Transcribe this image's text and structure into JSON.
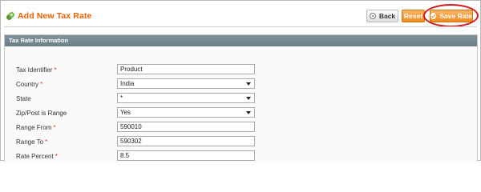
{
  "header": {
    "title": "Add New Tax Rate",
    "title_icon": "tax-rate-icon",
    "back_label": "Back",
    "reset_label": "Reset",
    "save_label": "Save Rate"
  },
  "section": {
    "title": "Tax Rate Information"
  },
  "form": {
    "tax_identifier": {
      "label": "Tax Identifier",
      "required": "*",
      "value": "Product"
    },
    "country": {
      "label": "Country",
      "required": "*",
      "value": "India"
    },
    "state": {
      "label": "State",
      "value": "*"
    },
    "zip_post_range": {
      "label": "Zip/Post is Range",
      "value": "Yes"
    },
    "range_from": {
      "label": "Range From",
      "required": "*",
      "value": "590010"
    },
    "range_to": {
      "label": "Range To",
      "required": "*",
      "value": "590302"
    },
    "rate_percent": {
      "label": "Rate Percent",
      "required": "*",
      "value": "8.5"
    }
  },
  "colors": {
    "title_accent": "#eb5e00",
    "button_orange": "#ee8a1c",
    "section_header": "#738790",
    "highlight_ring": "#d4161b"
  }
}
